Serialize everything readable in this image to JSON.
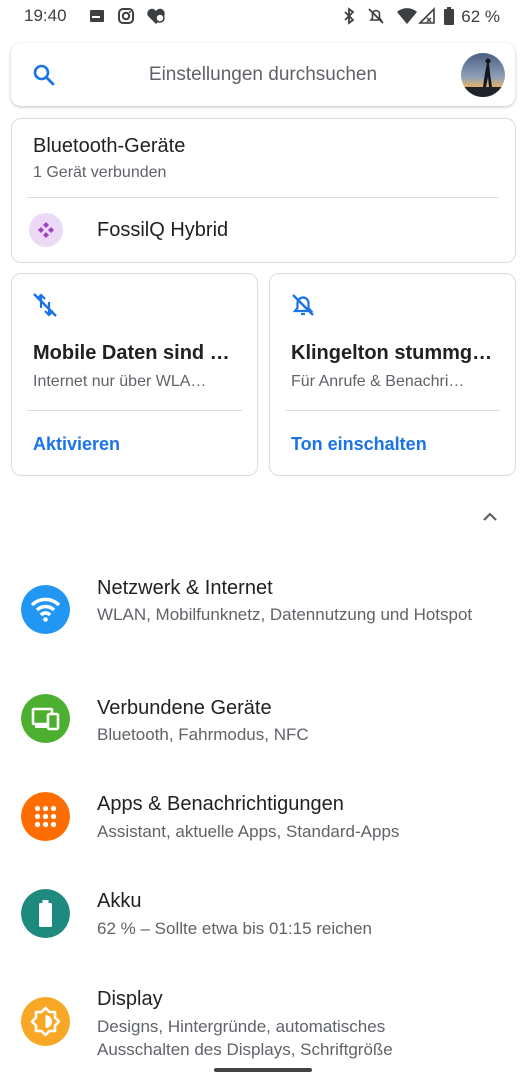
{
  "status": {
    "time": "19:40",
    "battery": "62 %"
  },
  "search": {
    "placeholder": "Einstellungen durchsuchen"
  },
  "bluetooth": {
    "title": "Bluetooth-Geräte",
    "subtitle": "1 Gerät verbunden",
    "device": "FossilQ Hybrid"
  },
  "suggestions": [
    {
      "title": "Mobile Daten sind …",
      "subtitle": "Internet nur über WLA…",
      "action": "Aktivieren"
    },
    {
      "title": "Klingelton stummg…",
      "subtitle": "Für Anrufe & Benachri…",
      "action": "Ton einschalten"
    }
  ],
  "settings": [
    {
      "title": "Netzwerk & Internet",
      "subtitle": "WLAN, Mobilfunknetz, Datennutzung und Hotspot",
      "color": "#2196f3",
      "icon": "wifi-icon"
    },
    {
      "title": "Verbundene Geräte",
      "subtitle": "Bluetooth, Fahrmodus, NFC",
      "color": "#4caf2f",
      "icon": "devices-icon"
    },
    {
      "title": "Apps & Benachrichtigungen",
      "subtitle": "Assistant, aktuelle Apps, Standard-Apps",
      "color": "#ff6d00",
      "icon": "apps-grid-icon"
    },
    {
      "title": "Akku",
      "subtitle": "62 % – Sollte etwa bis 01:15 reichen",
      "color": "#1e8a7d",
      "icon": "battery-icon"
    },
    {
      "title": "Display",
      "subtitle": "Designs, Hintergründe, automatisches Ausschalten des Displays, Schriftgröße",
      "color": "#f9a825",
      "icon": "brightness-icon"
    }
  ]
}
